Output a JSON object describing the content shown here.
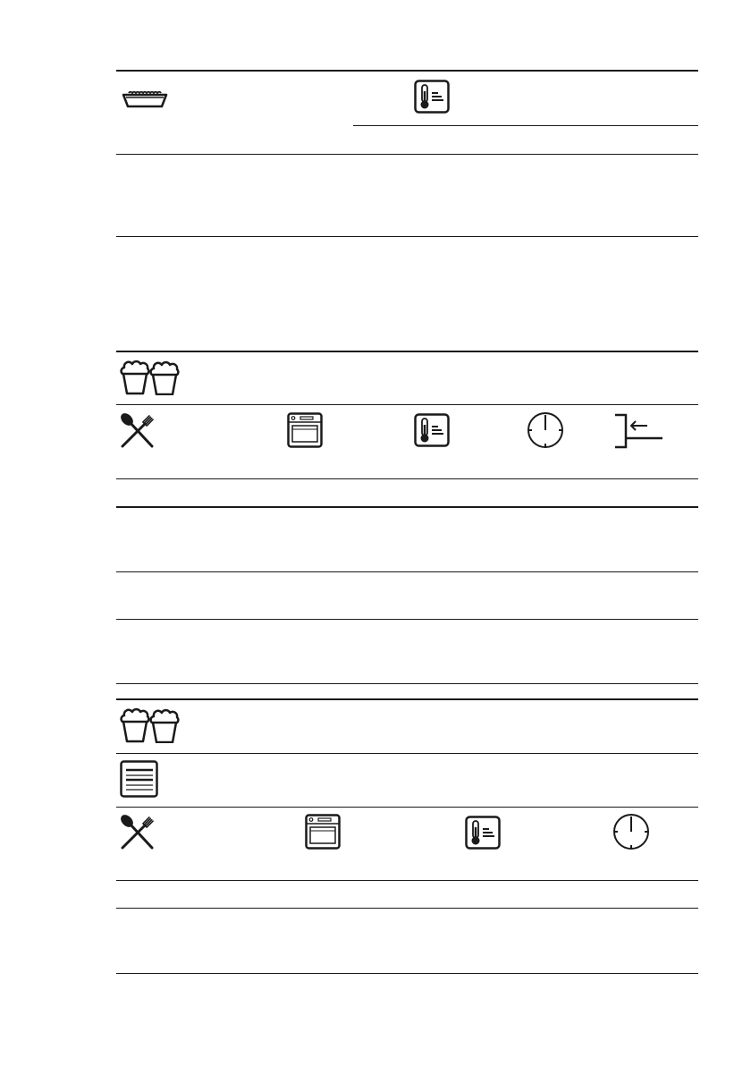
{
  "colors": {
    "rule": "#1a1a1a",
    "icon": "#1a1a1a",
    "background": "#ffffff"
  },
  "table_1": {
    "icons": [
      "baking-dish-icon",
      "thermometer-icon"
    ]
  },
  "table_2": {
    "header_icon": "muffins-icon",
    "column_icons": [
      "cutlery-icon",
      "oven-icon",
      "thermometer-icon",
      "clock-icon",
      "shelf-level-icon"
    ]
  },
  "table_3": {
    "header_icons": [
      "muffins-icon",
      "tray-icon"
    ],
    "column_icons": [
      "cutlery-icon",
      "oven-icon",
      "thermometer-icon",
      "clock-icon"
    ]
  }
}
